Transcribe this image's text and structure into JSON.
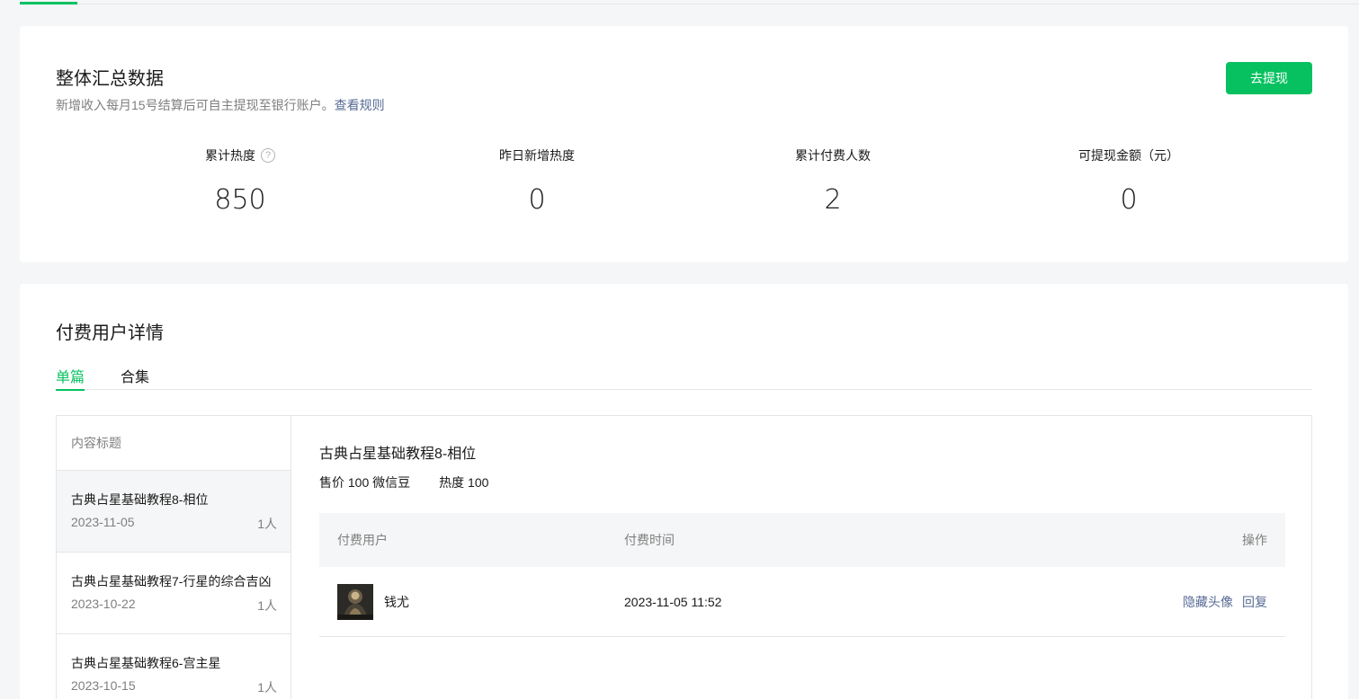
{
  "summary": {
    "title": "整体汇总数据",
    "desc": "新增收入每月15号结算后可自主提现至银行账户。",
    "rule_link": "查看规则",
    "withdraw_button": "去提现",
    "help_icon": "?",
    "stats": [
      {
        "label": "累计热度",
        "value": "850"
      },
      {
        "label": "昨日新增热度",
        "value": "0"
      },
      {
        "label": "累计付费人数",
        "value": "2"
      },
      {
        "label": "可提现金额（元）",
        "value": "0"
      }
    ]
  },
  "detail": {
    "title": "付费用户详情",
    "tabs": [
      {
        "label": "单篇"
      },
      {
        "label": "合集"
      }
    ],
    "list_header": "内容标题",
    "items": [
      {
        "title": "古典占星基础教程8-相位",
        "date": "2023-11-05",
        "count": "1人"
      },
      {
        "title": "古典占星基础教程7-行星的综合吉凶",
        "date": "2023-10-22",
        "count": "1人"
      },
      {
        "title": "古典占星基础教程6-宫主星",
        "date": "2023-10-15",
        "count": "1人"
      }
    ],
    "selected": {
      "title": "古典占星基础教程8-相位",
      "price": "售价 100 微信豆",
      "heat": "热度 100"
    },
    "table": {
      "headers": {
        "user": "付费用户",
        "time": "付费时间",
        "ops": "操作"
      },
      "rows": [
        {
          "user": "钱尤",
          "time": "2023-11-05 11:52",
          "op_hide": "隐藏头像",
          "op_reply": "回复"
        }
      ]
    }
  },
  "colors": {
    "accent": "#07c160",
    "link": "#576b95",
    "muted": "#7f7f7f",
    "background": "#f5f6f7"
  }
}
